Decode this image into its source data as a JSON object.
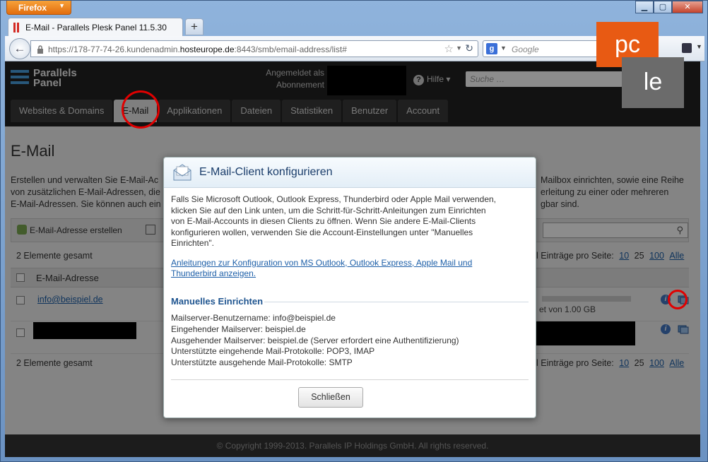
{
  "browser": {
    "firefox_label": "Firefox",
    "tab_title": "E-Mail - Parallels Plesk Panel 11.5.30",
    "url_prefix": "https://178-77-74-26.kundenadmin.",
    "url_host": "hosteurope.de",
    "url_suffix": ":8443/smb/email-address/list#",
    "search_placeholder": "Google"
  },
  "plesk": {
    "logo_line1": "Parallels",
    "logo_line2": "Panel",
    "logged_in_line1": "Angemeldet als",
    "logged_in_line2": "Abonnement",
    "help_label": "Hilfe",
    "search_placeholder": "Suche …",
    "tabs": [
      "Websites & Domains",
      "E-Mail",
      "Applikationen",
      "Dateien",
      "Statistiken",
      "Benutzer",
      "Account"
    ]
  },
  "page": {
    "title": "E-Mail",
    "desc_left_1": "Erstellen und verwalten Sie E-Mail-Ac",
    "desc_left_2": "von zusätzlichen E-Mail-Adressen, die",
    "desc_left_3": "E-Mail-Adressen. Sie können auch ein",
    "desc_right_1": "Mailbox einrichten, sowie eine Reihe",
    "desc_right_2": "erleitung zu einer oder mehreren",
    "desc_right_3": "gbar sind.",
    "create_button": "E-Mail-Adresse erstellen",
    "total_top": "2 Elemente gesamt",
    "total_bottom": "2 Elemente gesamt",
    "per_page_label": "l Einträge pro Seite:",
    "per_page_options": [
      "10",
      "25",
      "100",
      "Alle"
    ],
    "column_email": "E-Mail-Adresse",
    "row1_email": "info@beispiel.de",
    "row1_usage": "et von 1.00 GB",
    "footer": "© Copyright 1999-2013. Parallels IP Holdings GmbH. All rights reserved."
  },
  "dialog": {
    "title": "E-Mail-Client konfigurieren",
    "intro_1": "Falls Sie Microsoft Outlook, Outlook Express, Thunderbird oder Apple Mail verwenden,",
    "intro_2": "klicken Sie auf den Link unten, um die Schritt-für-Schritt-Anleitungen zum Einrichten",
    "intro_3": "von E-Mail-Accounts in diesen Clients zu öffnen. Wenn Sie andere E-Mail-Clients",
    "intro_4": "konfigurieren wollen, verwenden Sie die Account-Einstellungen unter \"Manuelles",
    "intro_5": "Einrichten\".",
    "link_1": "Anleitungen zur Konfiguration von MS Outlook, Outlook Express, Apple Mail und",
    "link_2": "Thunderbird anzeigen.",
    "section_title": "Manuelles Einrichten",
    "detail_1": "Mailserver-Benutzername: info@beispiel.de",
    "detail_2": "Eingehender Mailserver: beispiel.de",
    "detail_3": "Ausgehender Mailserver: beispiel.de (Server erfordert eine Authentifizierung)",
    "detail_4": "Unterstützte eingehende Mail-Protokolle: POP3, IMAP",
    "detail_5": "Unterstützte ausgehende Mail-Protokolle: SMTP",
    "close_button": "Schließen"
  },
  "watermark": {
    "top": "pc",
    "bottom": "le"
  },
  "colors": {
    "plesk_header": "#222222",
    "accent_link": "#1d5fa8",
    "highlight_circle": "#e00000",
    "watermark_orange": "#e85a13"
  }
}
